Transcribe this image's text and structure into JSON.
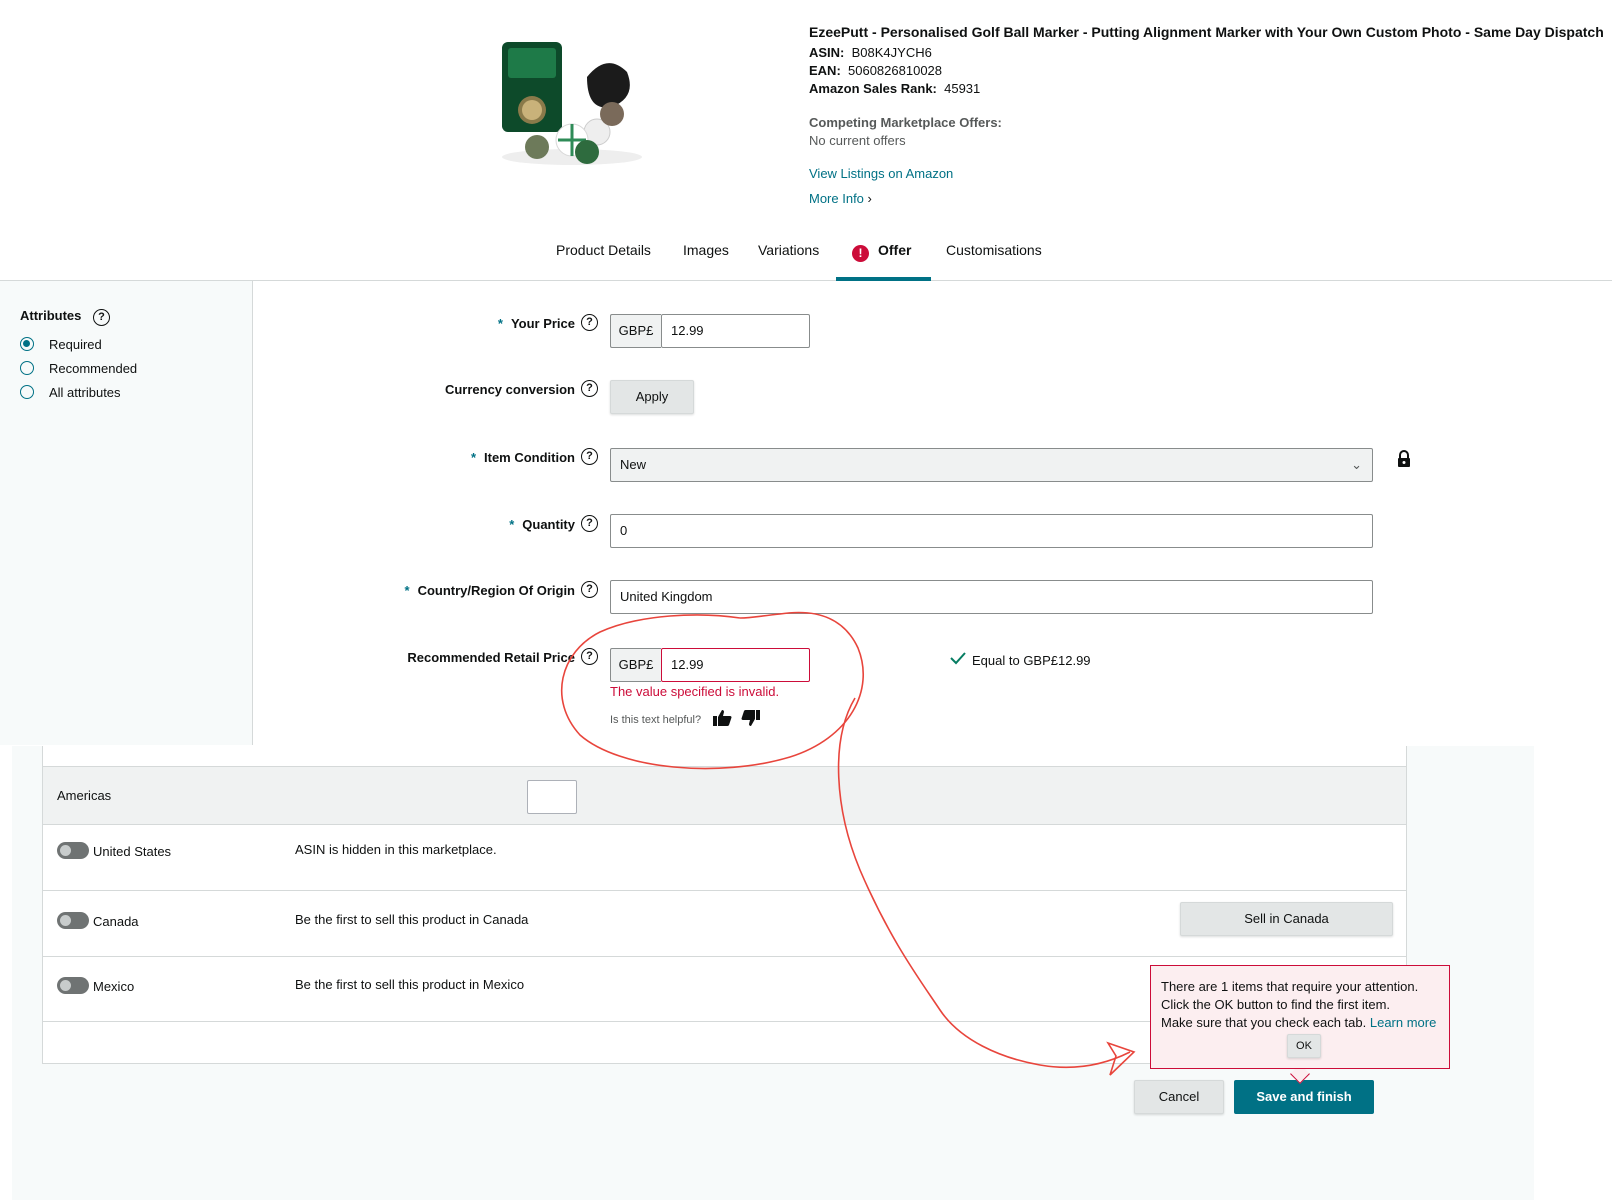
{
  "product": {
    "title": "EzeePutt - Personalised Golf Ball Marker - Putting Alignment Marker with Your Own Custom Photo - Same Day Dispatch",
    "asin_label": "ASIN:",
    "asin": "B08K4JYCH6",
    "ean_label": "EAN:",
    "ean": "5060826810028",
    "rank_label": "Amazon Sales Rank:",
    "rank": "45931",
    "competing_label": "Competing Marketplace Offers:",
    "competing_value": "No current offers",
    "view_listings": "View Listings on Amazon",
    "more_info": "More Info"
  },
  "tabs": {
    "product_details": "Product Details",
    "images": "Images",
    "variations": "Variations",
    "offer": "Offer",
    "customisations": "Customisations",
    "offer_alert": "!"
  },
  "sidebar": {
    "title": "Attributes",
    "options": [
      "Required",
      "Recommended",
      "All attributes"
    ],
    "selected": "Required"
  },
  "form": {
    "your_price": {
      "label": "Your Price",
      "currency": "GBP£",
      "value": "12.99"
    },
    "currency_conversion": {
      "label": "Currency conversion",
      "button": "Apply"
    },
    "item_condition": {
      "label": "Item Condition",
      "value": "New"
    },
    "quantity": {
      "label": "Quantity",
      "value": "0"
    },
    "country_origin": {
      "label": "Country/Region Of Origin",
      "value": "United Kingdom"
    },
    "rrp": {
      "label": "Recommended Retail Price",
      "currency": "GBP£",
      "value": "12.99",
      "error": "The value specified is invalid.",
      "helpful": "Is this text helpful?",
      "equal_text": "Equal to GBP£12.99"
    },
    "required_marker": "*",
    "help_glyph": "?"
  },
  "marketplaces": {
    "region": "Americas",
    "rows": [
      {
        "name": "United States",
        "status": "ASIN is hidden in this marketplace."
      },
      {
        "name": "Canada",
        "status": "Be the first to sell this product in Canada",
        "button": "Sell in Canada"
      },
      {
        "name": "Mexico",
        "status": "Be the first to sell this product in Mexico"
      }
    ]
  },
  "popover": {
    "line1": "There are 1 items that require your attention.",
    "line2": "Click the OK button to find the first item.",
    "line3": "Make sure that you check each tab.",
    "learn_more": "Learn more",
    "ok": "OK"
  },
  "actions": {
    "cancel": "Cancel",
    "save": "Save and finish"
  },
  "colors": {
    "accent": "#007185",
    "error": "#cc0c39",
    "annotation": "#e8453c"
  },
  "icons": [
    "help-icon",
    "lock-icon",
    "chevron-down-icon",
    "chevron-right-icon",
    "check-icon",
    "thumbs-up-icon",
    "thumbs-down-icon",
    "alert-icon"
  ]
}
